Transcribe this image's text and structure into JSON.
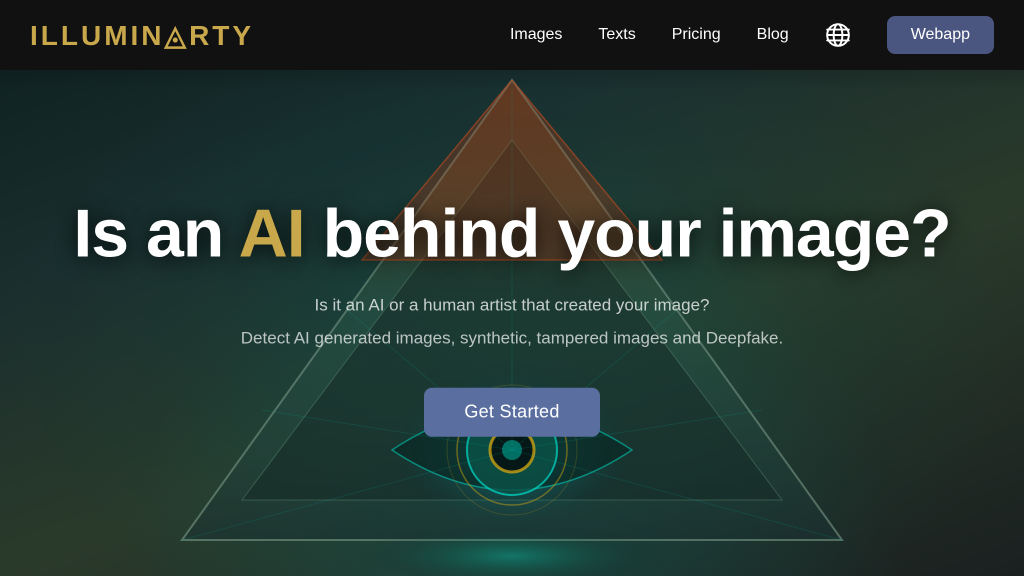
{
  "nav": {
    "logo": "ILLUMIN◬RTY",
    "logo_part1": "ILLUMIN",
    "logo_part2": "RTY",
    "links": [
      {
        "label": "Images",
        "href": "#"
      },
      {
        "label": "Texts",
        "href": "#"
      },
      {
        "label": "Pricing",
        "href": "#"
      },
      {
        "label": "Blog",
        "href": "#"
      }
    ],
    "webapp_label": "Webapp"
  },
  "hero": {
    "title_prefix": "Is an ",
    "title_ai": "AI",
    "title_suffix": " behind your image?",
    "subtitle1": "Is it an AI or a human artist that created your image?",
    "subtitle2": "Detect AI generated images, synthetic, tampered images and Deepfake.",
    "cta_label": "Get Started"
  },
  "colors": {
    "gold": "#c9a84c",
    "nav_bg": "#111111",
    "btn_bg": "#4a5680",
    "cta_bg": "#5a6fa0"
  }
}
